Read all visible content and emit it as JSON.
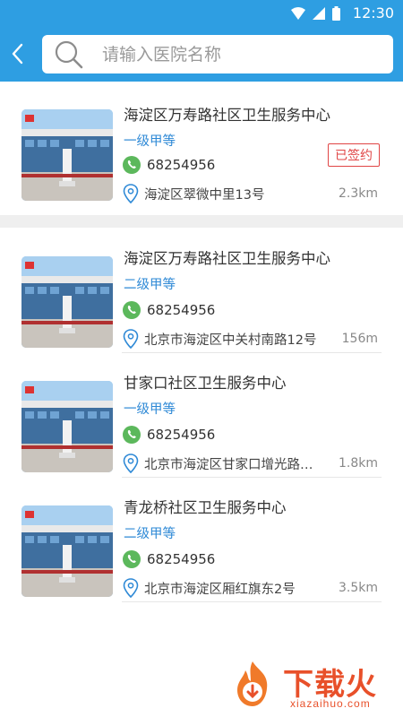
{
  "status_bar": {
    "time": "12:30"
  },
  "search": {
    "placeholder": "请输入医院名称"
  },
  "featured": {
    "name": "海淀区万寿路社区卫生服务中心",
    "level": "一级甲等",
    "phone": "68254956",
    "address": "海淀区翠微中里13号",
    "distance": "2.3km",
    "badge": "已签约"
  },
  "hospitals": [
    {
      "name": "海淀区万寿路社区卫生服务中心",
      "level": "二级甲等",
      "phone": "68254956",
      "address": "北京市海淀区中关村南路12号",
      "distance": "156m"
    },
    {
      "name": "甘家口社区卫生服务中心",
      "level": "一级甲等",
      "phone": "68254956",
      "address": "北京市海淀区甘家口增光路…",
      "distance": "1.8km"
    },
    {
      "name": "青龙桥社区卫生服务中心",
      "level": "二级甲等",
      "phone": "68254956",
      "address": "北京市海淀区厢红旗东2号",
      "distance": "3.5km"
    }
  ],
  "watermark": {
    "title": "下载火",
    "url": "xiazaihuo.com"
  },
  "colors": {
    "primary": "#2e9ee2",
    "level_text": "#2e89d6",
    "badge": "#e04545",
    "phone_icon": "#5cb85c"
  }
}
